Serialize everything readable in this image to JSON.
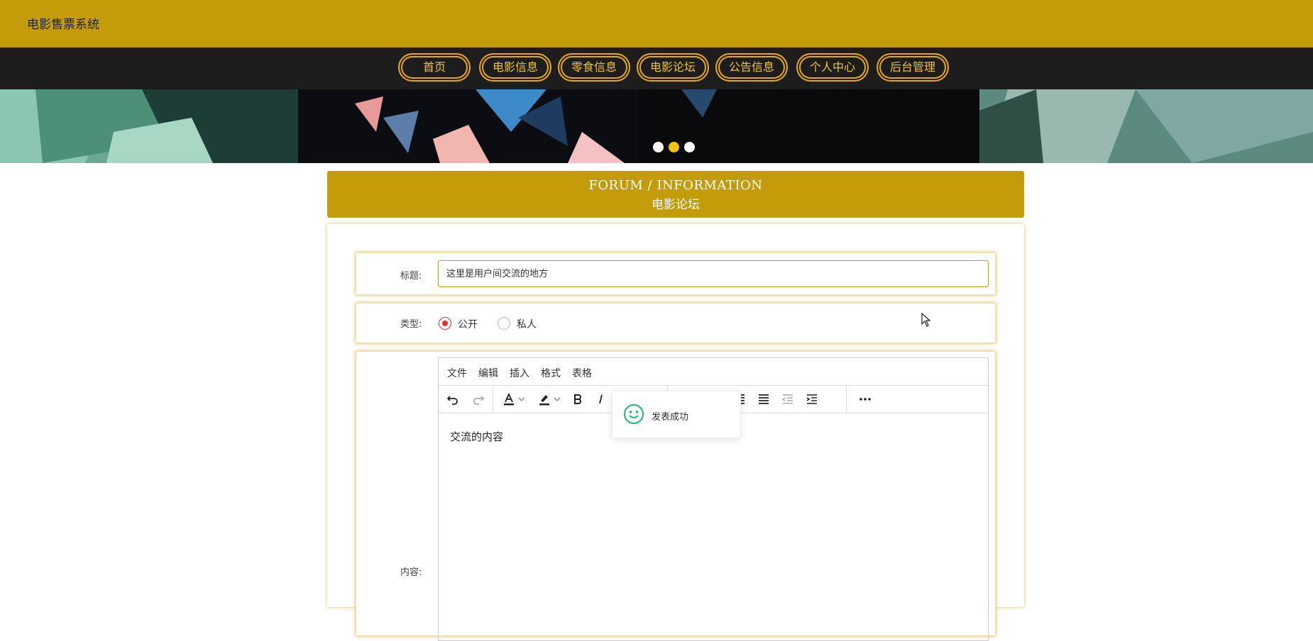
{
  "app": {
    "title": "电影售票系统"
  },
  "nav": {
    "items": [
      {
        "label": "首页"
      },
      {
        "label": "电影信息"
      },
      {
        "label": "零食信息"
      },
      {
        "label": "电影论坛"
      },
      {
        "label": "公告信息"
      },
      {
        "label": "个人中心"
      },
      {
        "label": "后台管理"
      }
    ]
  },
  "banner": {
    "slides": 3,
    "active_slide": 2
  },
  "section": {
    "title_en": "FORUM / INFORMATION",
    "title_cn": "电影论坛"
  },
  "form": {
    "title_label": "标题:",
    "title_value": "这里是用户间交流的地方",
    "type_label": "类型:",
    "type_options": [
      {
        "label": "公开",
        "checked": true
      },
      {
        "label": "私人",
        "checked": false
      }
    ],
    "content_label": "内容:"
  },
  "editor": {
    "menus": [
      {
        "label": "文件"
      },
      {
        "label": "编辑"
      },
      {
        "label": "插入"
      },
      {
        "label": "格式"
      },
      {
        "label": "表格"
      }
    ],
    "content": "交流的内容"
  },
  "toast": {
    "message": "发表成功"
  },
  "colors": {
    "accent": "#c49b08",
    "nav_bg": "#1d1d1d",
    "nav_border": "#e8a812",
    "nav_text": "#f2c431",
    "radio_checked": "#dd3333",
    "success": "#1fb86c"
  }
}
